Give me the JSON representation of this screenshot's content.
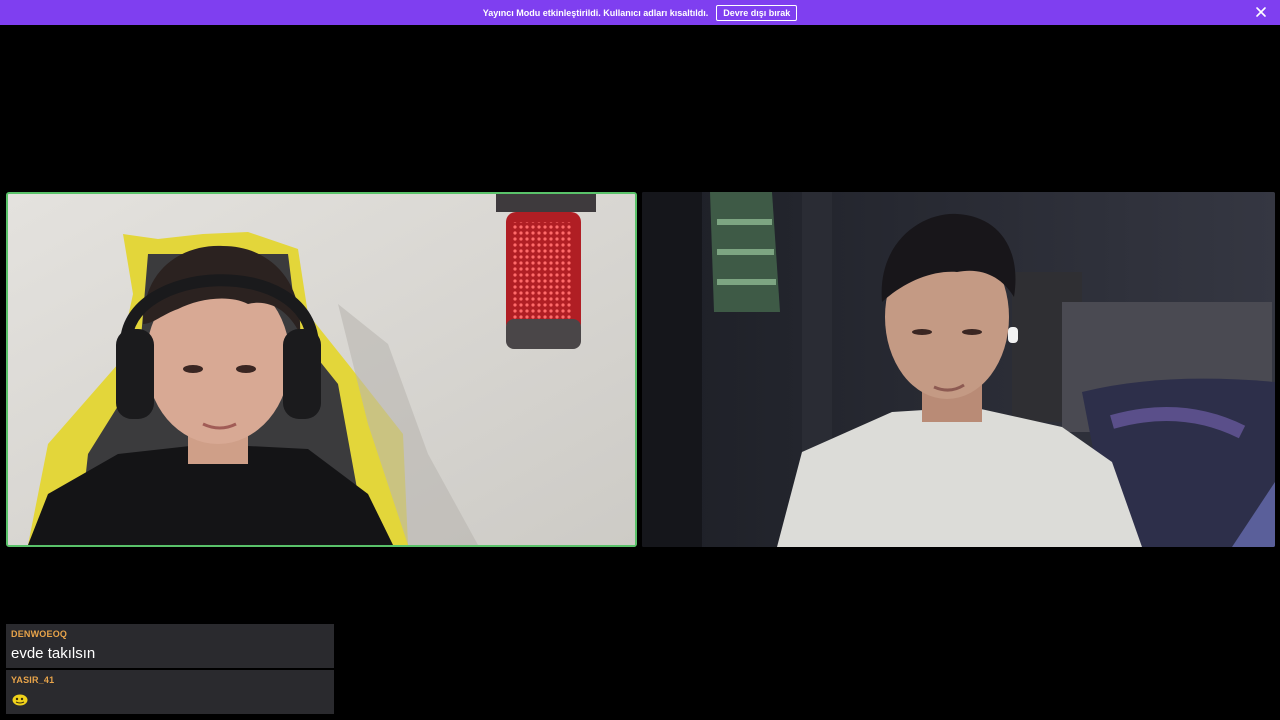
{
  "banner": {
    "message": "Yayıncı Modu etkinleştirildi. Kullanıcı adları kısaltıldı.",
    "disable_label": "Devre dışı bırak",
    "close_icon": "close-icon",
    "background_color": "#7f3ff0"
  },
  "video_tiles": [
    {
      "name": "left-participant",
      "speaking": true,
      "highlight_color": "#5ac26a"
    },
    {
      "name": "right-participant",
      "speaking": false
    }
  ],
  "chat": {
    "messages": [
      {
        "username": "DENWOEOQ",
        "text": "evde takılsın"
      },
      {
        "username": "YASIR_41",
        "emote": "emote-icon"
      }
    ],
    "username_color": "#e8a44a"
  }
}
